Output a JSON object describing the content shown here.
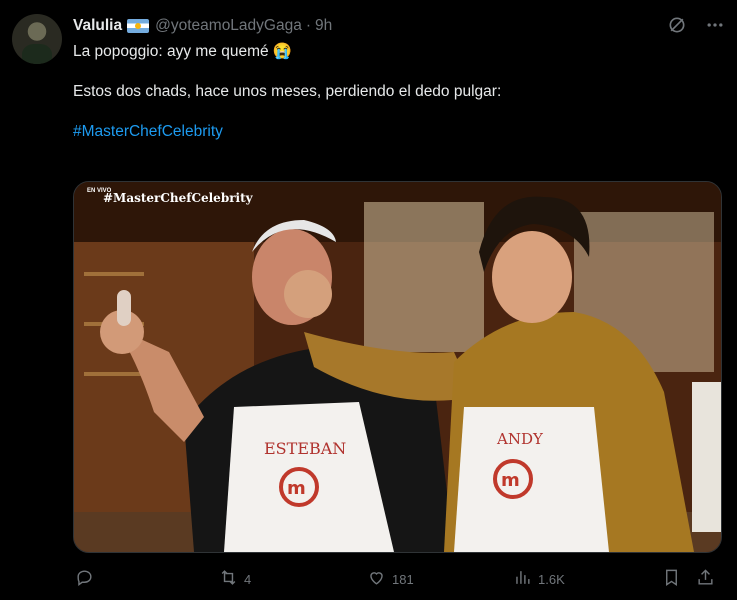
{
  "tweet": {
    "author_name": "Valulia",
    "flag_icon": "argentina-flag-icon",
    "handle": "@yoteamoLadyGaga",
    "separator": "·",
    "time": "9h",
    "line1": "La popoggio: ayy me quemé 😭",
    "line2": "Estos dos chads, hace unos meses, perdiendo el dedo pulgar:",
    "hashtag": "#MasterChefCelebrity"
  },
  "media": {
    "live_label": "EN VIVO",
    "overlay_hashtag": "#MasterChefCelebrity",
    "apron_left_name": "ESTEBAN",
    "apron_right_name": "ANDY"
  },
  "actions": {
    "reply_count": "",
    "retweet_count": "4",
    "like_count": "181",
    "views_count": "1.6K"
  },
  "colors": {
    "accent": "#1d9bf0",
    "muted": "#71767b",
    "text": "#e7e9ea",
    "background": "#000000"
  }
}
